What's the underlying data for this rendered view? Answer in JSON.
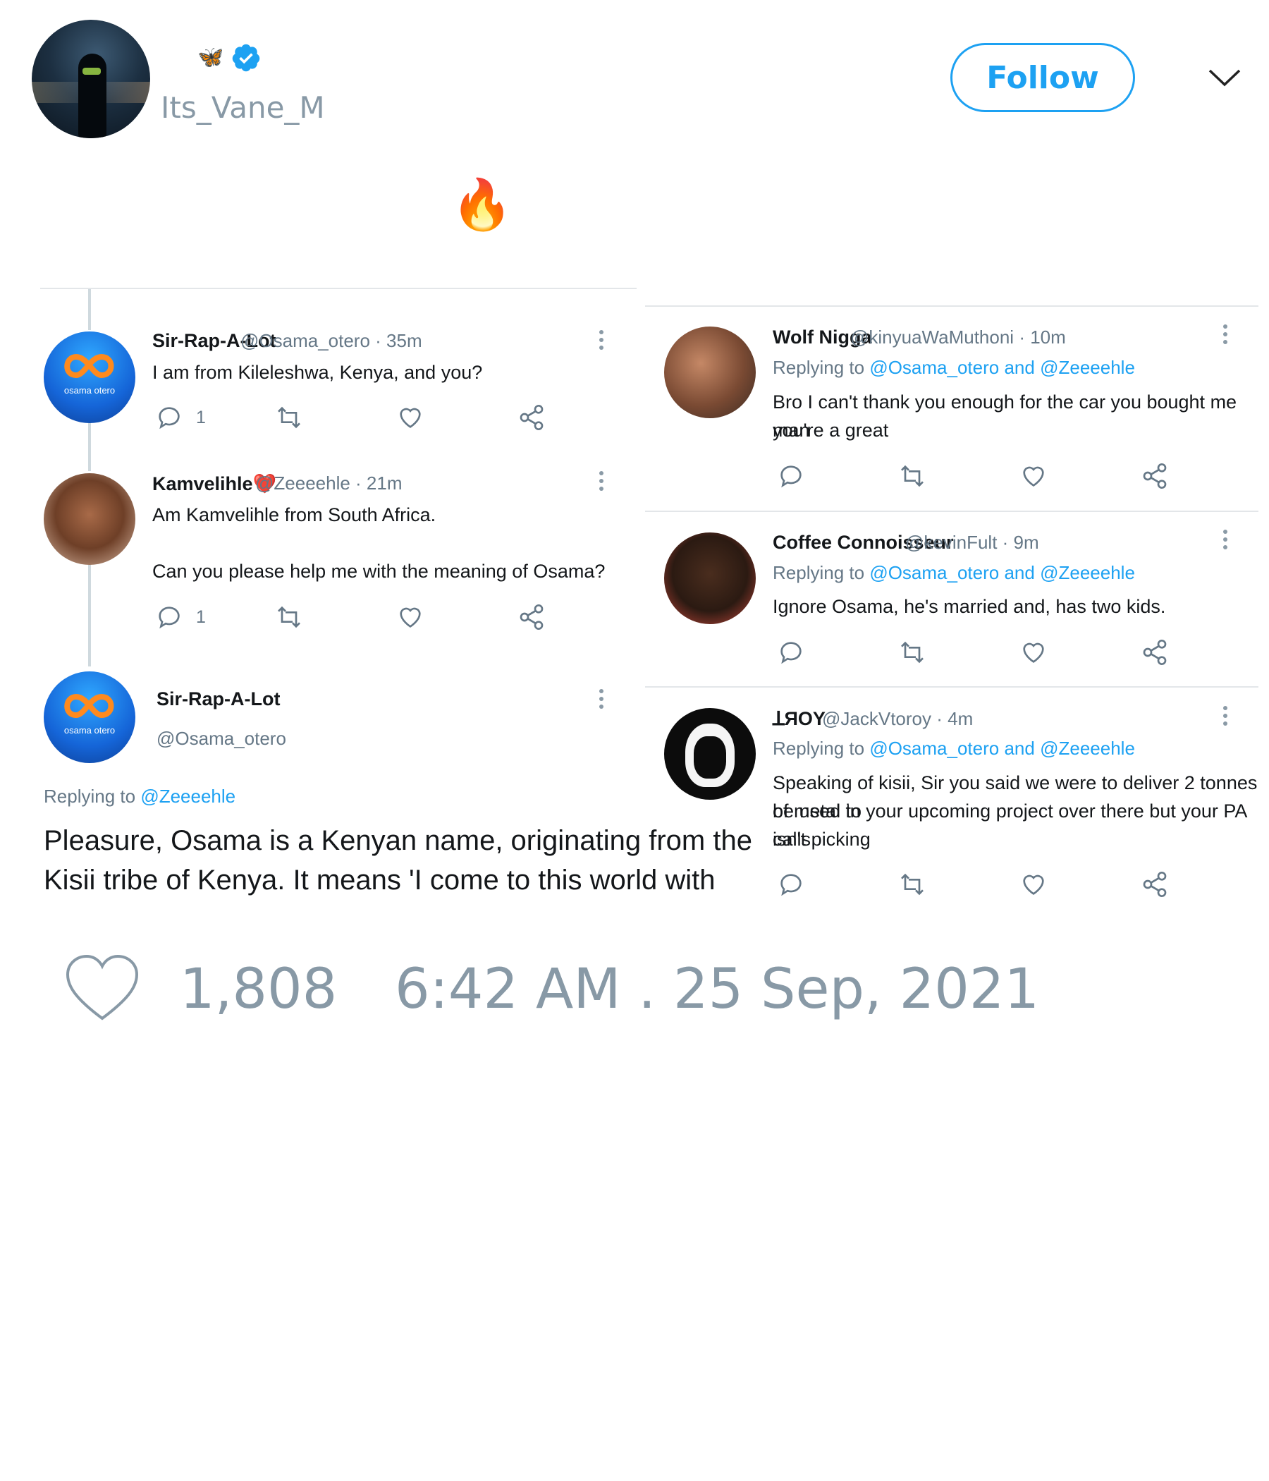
{
  "tweet": {
    "author_handle": "Its_Vane_M",
    "author_emoji": "🦋",
    "follow_label": "Follow",
    "text_emoji": "🔥",
    "likes": "1,808",
    "timestamp": "6:42 AM . 25 Sep, 2021"
  },
  "left_panel": {
    "replies": [
      {
        "name": "Sir-Rap-A-Lot",
        "handle": "@Osama_otero",
        "time": "· 35m",
        "text": "I am from Kileleshwa, Kenya, and you?",
        "reply_count": "1",
        "avatar_label": "osama otero"
      },
      {
        "name": "Kamvelihle❤️",
        "handle": "@Zeeeehle",
        "time": "· 21m",
        "text_line1": "Am Kamvelihle from South Africa.",
        "text_line2": "Can you please help me with the meaning of Osama?",
        "reply_count": "1"
      }
    ],
    "main": {
      "name": "Sir-Rap-A-Lot",
      "handle": "@Osama_otero",
      "replying_prefix": "Replying to",
      "replying_to": "@Zeeeehle",
      "text_line1": "Pleasure, Osama is a Kenyan name, originating from the",
      "text_line2": "Kisii tribe of Kenya. It means 'I come to this world with",
      "avatar_label": "osama otero"
    }
  },
  "right_panel": {
    "replying_prefix": "Replying to",
    "replying_to_1": "@Osama_otero",
    "replying_and": "and",
    "replying_to_2": "@Zeeeehle",
    "replies": [
      {
        "name": "Wolf Nigga",
        "handle": "@kinyuaWaMuthoni",
        "time": "· 10m",
        "text_line1": "Bro I can't thank you enough for the car you bought me you're a great",
        "text_line2": "man"
      },
      {
        "name": "Coffee Connoisseur",
        "handle": "@kevinFult",
        "time": "· 9m",
        "text_line1": "Ignore Osama, he's married and, has two kids."
      },
      {
        "name": "ꓕЯOY",
        "handle": "@JackVtoroy",
        "time": "· 4m",
        "text_line1": "Speaking of kisii, Sir you said we were to deliver 2 tonnes of metal to",
        "text_line2": "be used in your upcoming project over there but your PA isn't picking",
        "text_line3": "calls."
      }
    ]
  },
  "colors": {
    "accent": "#1da1f2",
    "muted": "#8899a6",
    "text": "#14171a"
  },
  "icons": [
    "verified-badge-icon",
    "chevron-down-icon",
    "reply-icon",
    "retweet-icon",
    "like-icon",
    "share-icon",
    "more-icon",
    "heart-icon"
  ]
}
